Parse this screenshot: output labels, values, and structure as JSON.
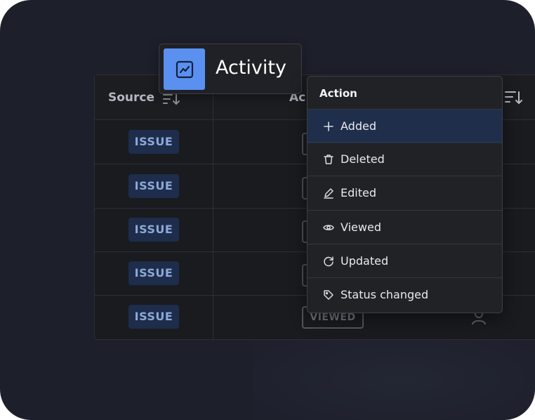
{
  "table": {
    "headers": {
      "source": "Source",
      "action": "Ac"
    },
    "rows": [
      {
        "source": "ISSUE"
      },
      {
        "source": "ISSUE"
      },
      {
        "source": "ISSUE"
      },
      {
        "source": "ISSUE"
      },
      {
        "source": "ISSUE",
        "action": "VIEWED"
      }
    ]
  },
  "activity_chip": {
    "label": "Activity",
    "icon": "chart-line-icon"
  },
  "dropdown": {
    "title": "Action",
    "items": [
      {
        "label": "Added",
        "icon": "plus-icon",
        "selected": true
      },
      {
        "label": "Deleted",
        "icon": "trash-icon"
      },
      {
        "label": "Edited",
        "icon": "pencil-icon"
      },
      {
        "label": "Viewed",
        "icon": "eye-icon"
      },
      {
        "label": "Updated",
        "icon": "refresh-icon"
      },
      {
        "label": "Status changed",
        "icon": "tag-icon"
      }
    ]
  },
  "colors": {
    "background": "#1d1f2b",
    "accent": "#5a90f0",
    "badge_bg": "#1d2d4b",
    "badge_text": "#8ea8d8",
    "selected_item": "#1f2e4b"
  }
}
